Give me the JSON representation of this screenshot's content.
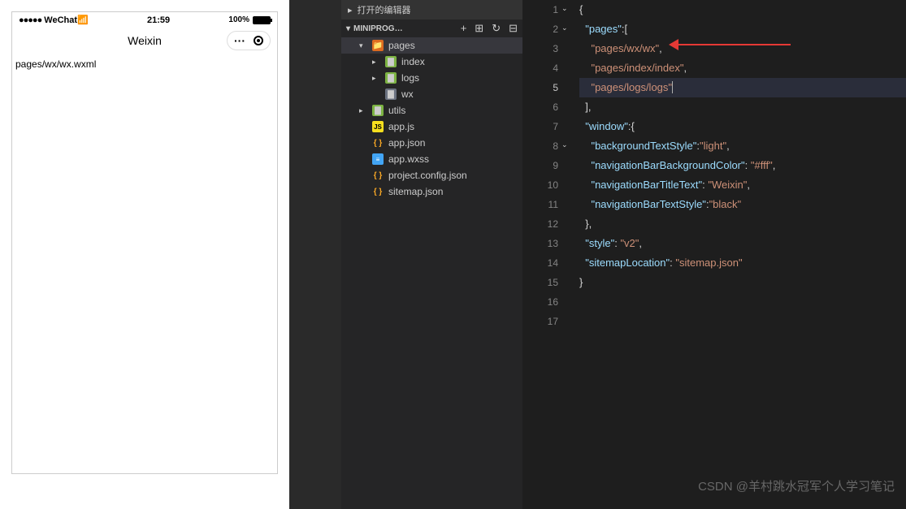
{
  "simulator": {
    "carrier": "WeChat",
    "signal": "●●●●●",
    "time": "21:59",
    "battery": "100%",
    "title": "Weixin",
    "menu": "···",
    "content": "pages/wx/wx.wxml"
  },
  "explorer": {
    "header": "打开的编辑器",
    "project": "MINIPROG…",
    "icons": {
      "new_file": "+",
      "new_folder": "⊞",
      "refresh": "↻",
      "collapse": "⊟"
    },
    "tree": {
      "pages": "pages",
      "index": "index",
      "logs": "logs",
      "wx": "wx",
      "utils": "utils",
      "appjs": "app.js",
      "appjson": "app.json",
      "appwxss": "app.wxss",
      "projjson": "project.config.json",
      "sitemap": "sitemap.json"
    }
  },
  "code": {
    "l1": "{",
    "l2": {
      "k": "\"pages\"",
      "p": ":["
    },
    "l3": {
      "v": "\"pages/wx/wx\"",
      "p": ","
    },
    "l4": {
      "v": "\"pages/index/index\"",
      "p": ","
    },
    "l5": {
      "v": "\"pages/logs/logs\""
    },
    "l6": "",
    "l7": "],",
    "l8": {
      "k": "\"window\"",
      "p": ":{"
    },
    "l9": {
      "k": "\"backgroundTextStyle\"",
      "p": ":",
      "v": "\"light\"",
      "e": ","
    },
    "l10": {
      "k": "\"navigationBarBackgroundColor\"",
      "p": ": ",
      "v": "\"#fff\"",
      "e": ","
    },
    "l11": {
      "k": "\"navigationBarTitleText\"",
      "p": ": ",
      "v": "\"Weixin\"",
      "e": ","
    },
    "l12": {
      "k": "\"navigationBarTextStyle\"",
      "p": ":",
      "v": "\"black\""
    },
    "l13": "},",
    "l14": {
      "k": "\"style\"",
      "p": ": ",
      "v": "\"v2\"",
      "e": ","
    },
    "l15": {
      "k": "\"sitemapLocation\"",
      "p": ": ",
      "v": "\"sitemap.json\""
    },
    "l16": "}",
    "lines": [
      "1",
      "2",
      "3",
      "4",
      "5",
      "6",
      "7",
      "8",
      "9",
      "10",
      "11",
      "12",
      "13",
      "14",
      "15",
      "16",
      "17"
    ]
  },
  "watermark": "CSDN @羊村跳水冠军个人学习笔记"
}
